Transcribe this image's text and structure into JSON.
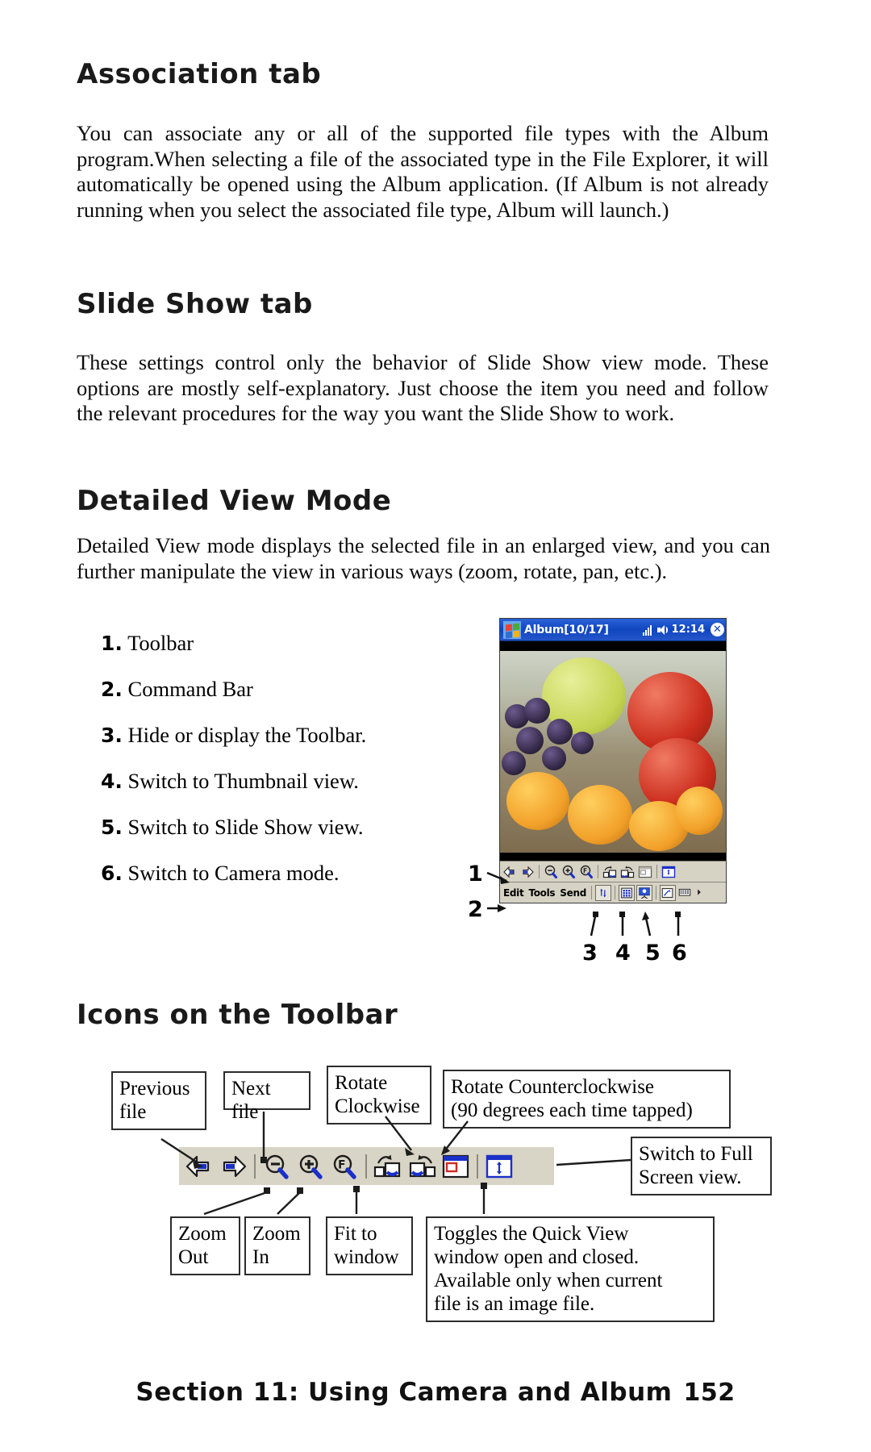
{
  "sections": {
    "association": {
      "heading": "Association tab",
      "paragraph": "You can associate any or all of the supported file types with the Album program.When selecting a file of the associated type in the File Explorer, it will automatically be opened using the Album application. (If Album is not already running when you select the associated file type, Album will launch.)"
    },
    "slideshow": {
      "heading": "Slide Show tab",
      "paragraph": "These settings control only the behavior of Slide Show view mode. These options are mostly self-explanatory. Just choose the item you need and follow the relevant procedures for the way you want the Slide Show to work."
    },
    "detailed": {
      "heading": "Detailed View Mode",
      "paragraph": "Detailed View mode displays the selected file in an enlarged view, and you can further manipulate the view in various ways (zoom, rotate, pan, etc.).",
      "list": [
        {
          "num": "1.",
          "text": "Toolbar"
        },
        {
          "num": "2.",
          "text": "Command Bar"
        },
        {
          "num": "3.",
          "text": "Hide or display the Toolbar."
        },
        {
          "num": "4.",
          "text": "Switch to Thumbnail view."
        },
        {
          "num": "5.",
          "text": "Switch to Slide Show view."
        },
        {
          "num": "6.",
          "text": "Switch to Camera mode."
        }
      ]
    },
    "icons_toolbar": {
      "heading": "Icons on the Toolbar"
    }
  },
  "pda": {
    "title": "Album[10/17]",
    "time": "12:14",
    "close_label": "✕",
    "command_bar": {
      "menus": [
        "Edit",
        "Tools",
        "Send"
      ]
    },
    "callouts": [
      "1",
      "2",
      "3",
      "4",
      "5",
      "6"
    ]
  },
  "icon_labels": {
    "previous_file": "Previous\nfile",
    "next_file": "Next file",
    "rotate_clockwise": "Rotate\nClockwise",
    "rotate_counterclockwise_l1": "Rotate Counterclockwise",
    "rotate_counterclockwise_l2": "(90 degrees each time tapped)",
    "switch_full_screen_l1": "Switch to Full",
    "switch_full_screen_l2": "Screen view.",
    "zoom_out_l1": "Zoom",
    "zoom_out_l2": "Out",
    "zoom_in_l1": "Zoom",
    "zoom_in_l2": "In",
    "fit_window_l1": "Fit to",
    "fit_window_l2": "window",
    "quick_view_l1": "Toggles the Quick View",
    "quick_view_l2": "window open and closed.",
    "quick_view_l3": "Available only when current",
    "quick_view_l4": "file is an image file."
  },
  "footer": {
    "text": "Section 11: Using Camera and Album",
    "page": "152"
  },
  "colors": {
    "titlebar_blue": "#1046bf",
    "toolbar_grey": "#d8d4c6",
    "icon_blue": "#1a30c8",
    "accent_red": "#d02a1e"
  }
}
